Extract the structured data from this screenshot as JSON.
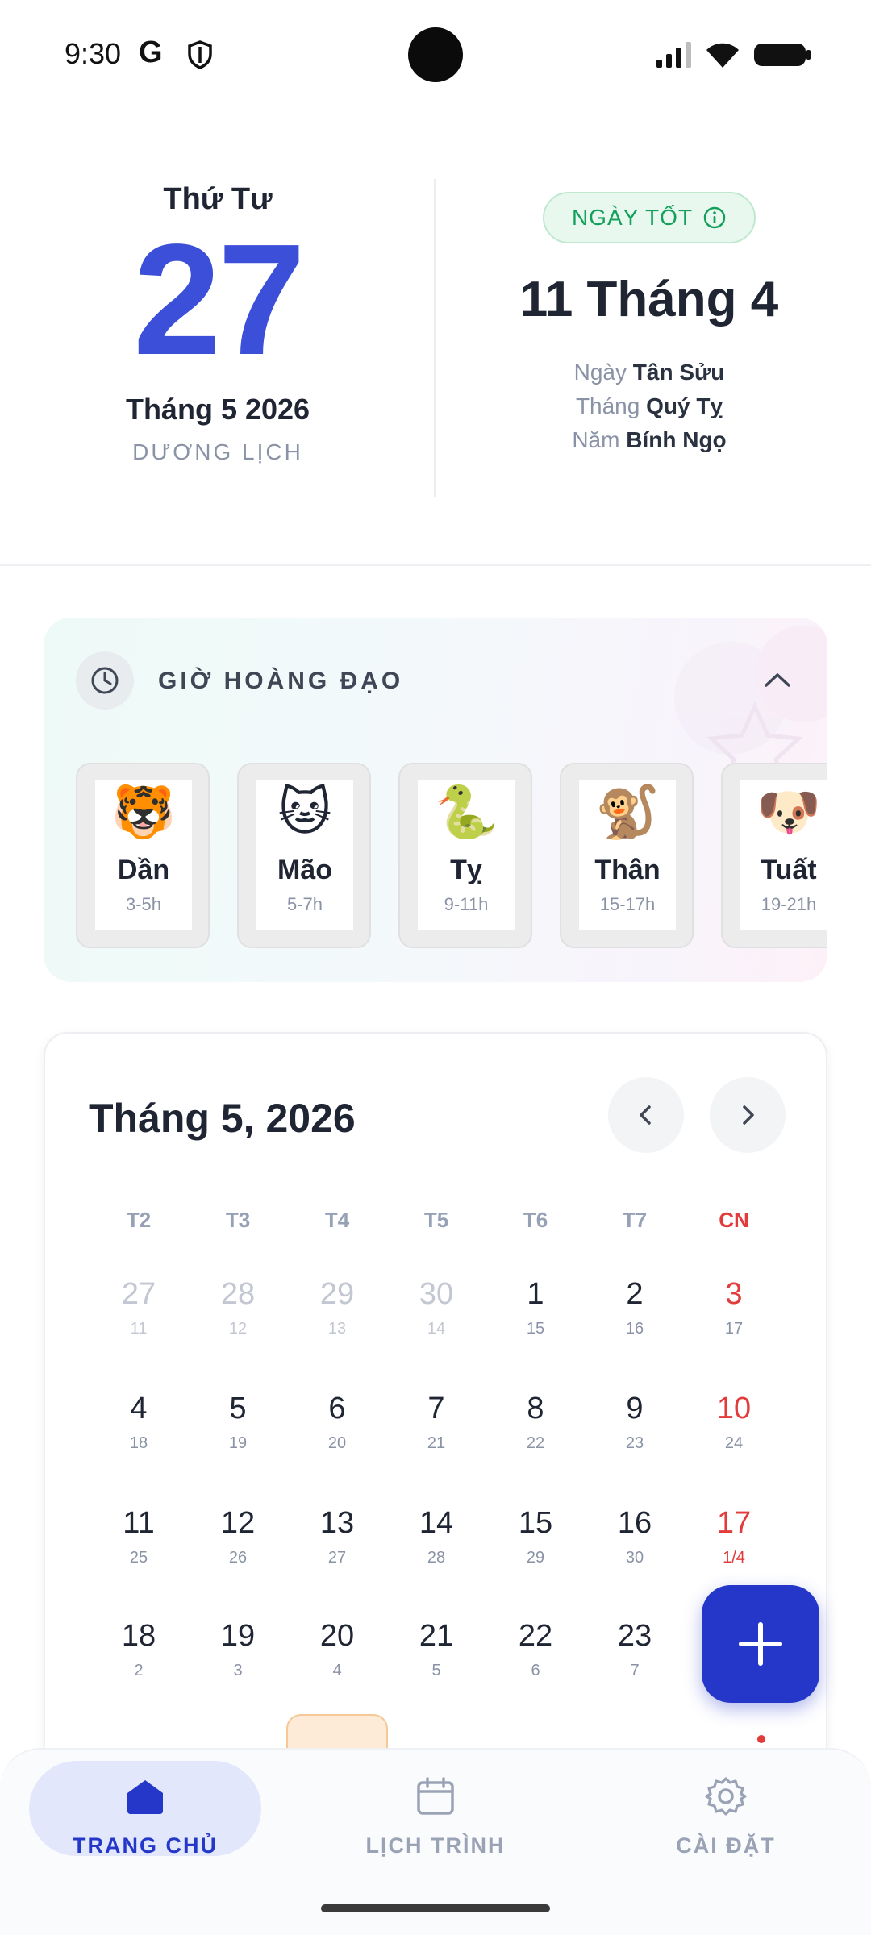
{
  "status_bar": {
    "time": "9:30",
    "google_glyph": "G",
    "icons": [
      "shield-icon",
      "signal-icon",
      "wifi-icon",
      "battery-icon"
    ]
  },
  "header": {
    "weekday": "Thứ Tư",
    "day": "27",
    "month_year": "Tháng 5 2026",
    "calendar_type": "DƯƠNG LỊCH",
    "badge": "NGÀY TỐT",
    "lunar_date": "11 Tháng 4",
    "can_chi": [
      {
        "label": "Ngày",
        "value": "Tân Sửu"
      },
      {
        "label": "Tháng",
        "value": "Quý Tỵ"
      },
      {
        "label": "Năm",
        "value": "Bính Ngọ"
      }
    ]
  },
  "hoang_dao": {
    "title": "GIỜ HOÀNG ĐẠO",
    "hours": [
      {
        "emoji": "🐯",
        "name": "Dần",
        "range": "3-5h"
      },
      {
        "emoji": "🐱",
        "name": "Mão",
        "range": "5-7h"
      },
      {
        "emoji": "🐍",
        "name": "Tỵ",
        "range": "9-11h"
      },
      {
        "emoji": "🐒",
        "name": "Thân",
        "range": "15-17h"
      },
      {
        "emoji": "🐶",
        "name": "Tuất",
        "range": "19-21h"
      }
    ]
  },
  "calendar": {
    "title": "Tháng 5, 2026",
    "weekdays": [
      "T2",
      "T3",
      "T4",
      "T5",
      "T6",
      "T7",
      "CN"
    ],
    "weeks": [
      [
        {
          "d": "27",
          "l": "11",
          "m": true
        },
        {
          "d": "28",
          "l": "12",
          "m": true
        },
        {
          "d": "29",
          "l": "13",
          "m": true
        },
        {
          "d": "30",
          "l": "14",
          "m": true
        },
        {
          "d": "1",
          "l": "15"
        },
        {
          "d": "2",
          "l": "16"
        },
        {
          "d": "3",
          "l": "17"
        }
      ],
      [
        {
          "d": "4",
          "l": "18"
        },
        {
          "d": "5",
          "l": "19"
        },
        {
          "d": "6",
          "l": "20"
        },
        {
          "d": "7",
          "l": "21"
        },
        {
          "d": "8",
          "l": "22"
        },
        {
          "d": "9",
          "l": "23"
        },
        {
          "d": "10",
          "l": "24"
        }
      ],
      [
        {
          "d": "11",
          "l": "25"
        },
        {
          "d": "12",
          "l": "26"
        },
        {
          "d": "13",
          "l": "27"
        },
        {
          "d": "14",
          "l": "28"
        },
        {
          "d": "15",
          "l": "29"
        },
        {
          "d": "16",
          "l": "30"
        },
        {
          "d": "17",
          "l": "1/4"
        }
      ],
      [
        {
          "d": "18",
          "l": "2"
        },
        {
          "d": "19",
          "l": "3"
        },
        {
          "d": "20",
          "l": "4"
        },
        {
          "d": "21",
          "l": "5"
        },
        {
          "d": "22",
          "l": "6"
        },
        {
          "d": "23",
          "l": "7"
        },
        {
          "d": "",
          "l": ""
        }
      ]
    ],
    "today": "27",
    "colors": {
      "accent": "#3b4fd8",
      "sunday": "#e23b3b",
      "today_bg": "#fdebd7"
    }
  },
  "fab": {
    "icon": "plus-icon"
  },
  "bottom_nav": [
    {
      "label": "TRANG CHỦ",
      "icon": "home-icon",
      "active": true
    },
    {
      "label": "LỊCH TRÌNH",
      "icon": "calendar-icon",
      "active": false
    },
    {
      "label": "CÀI ĐẶT",
      "icon": "gear-icon",
      "active": false
    }
  ]
}
